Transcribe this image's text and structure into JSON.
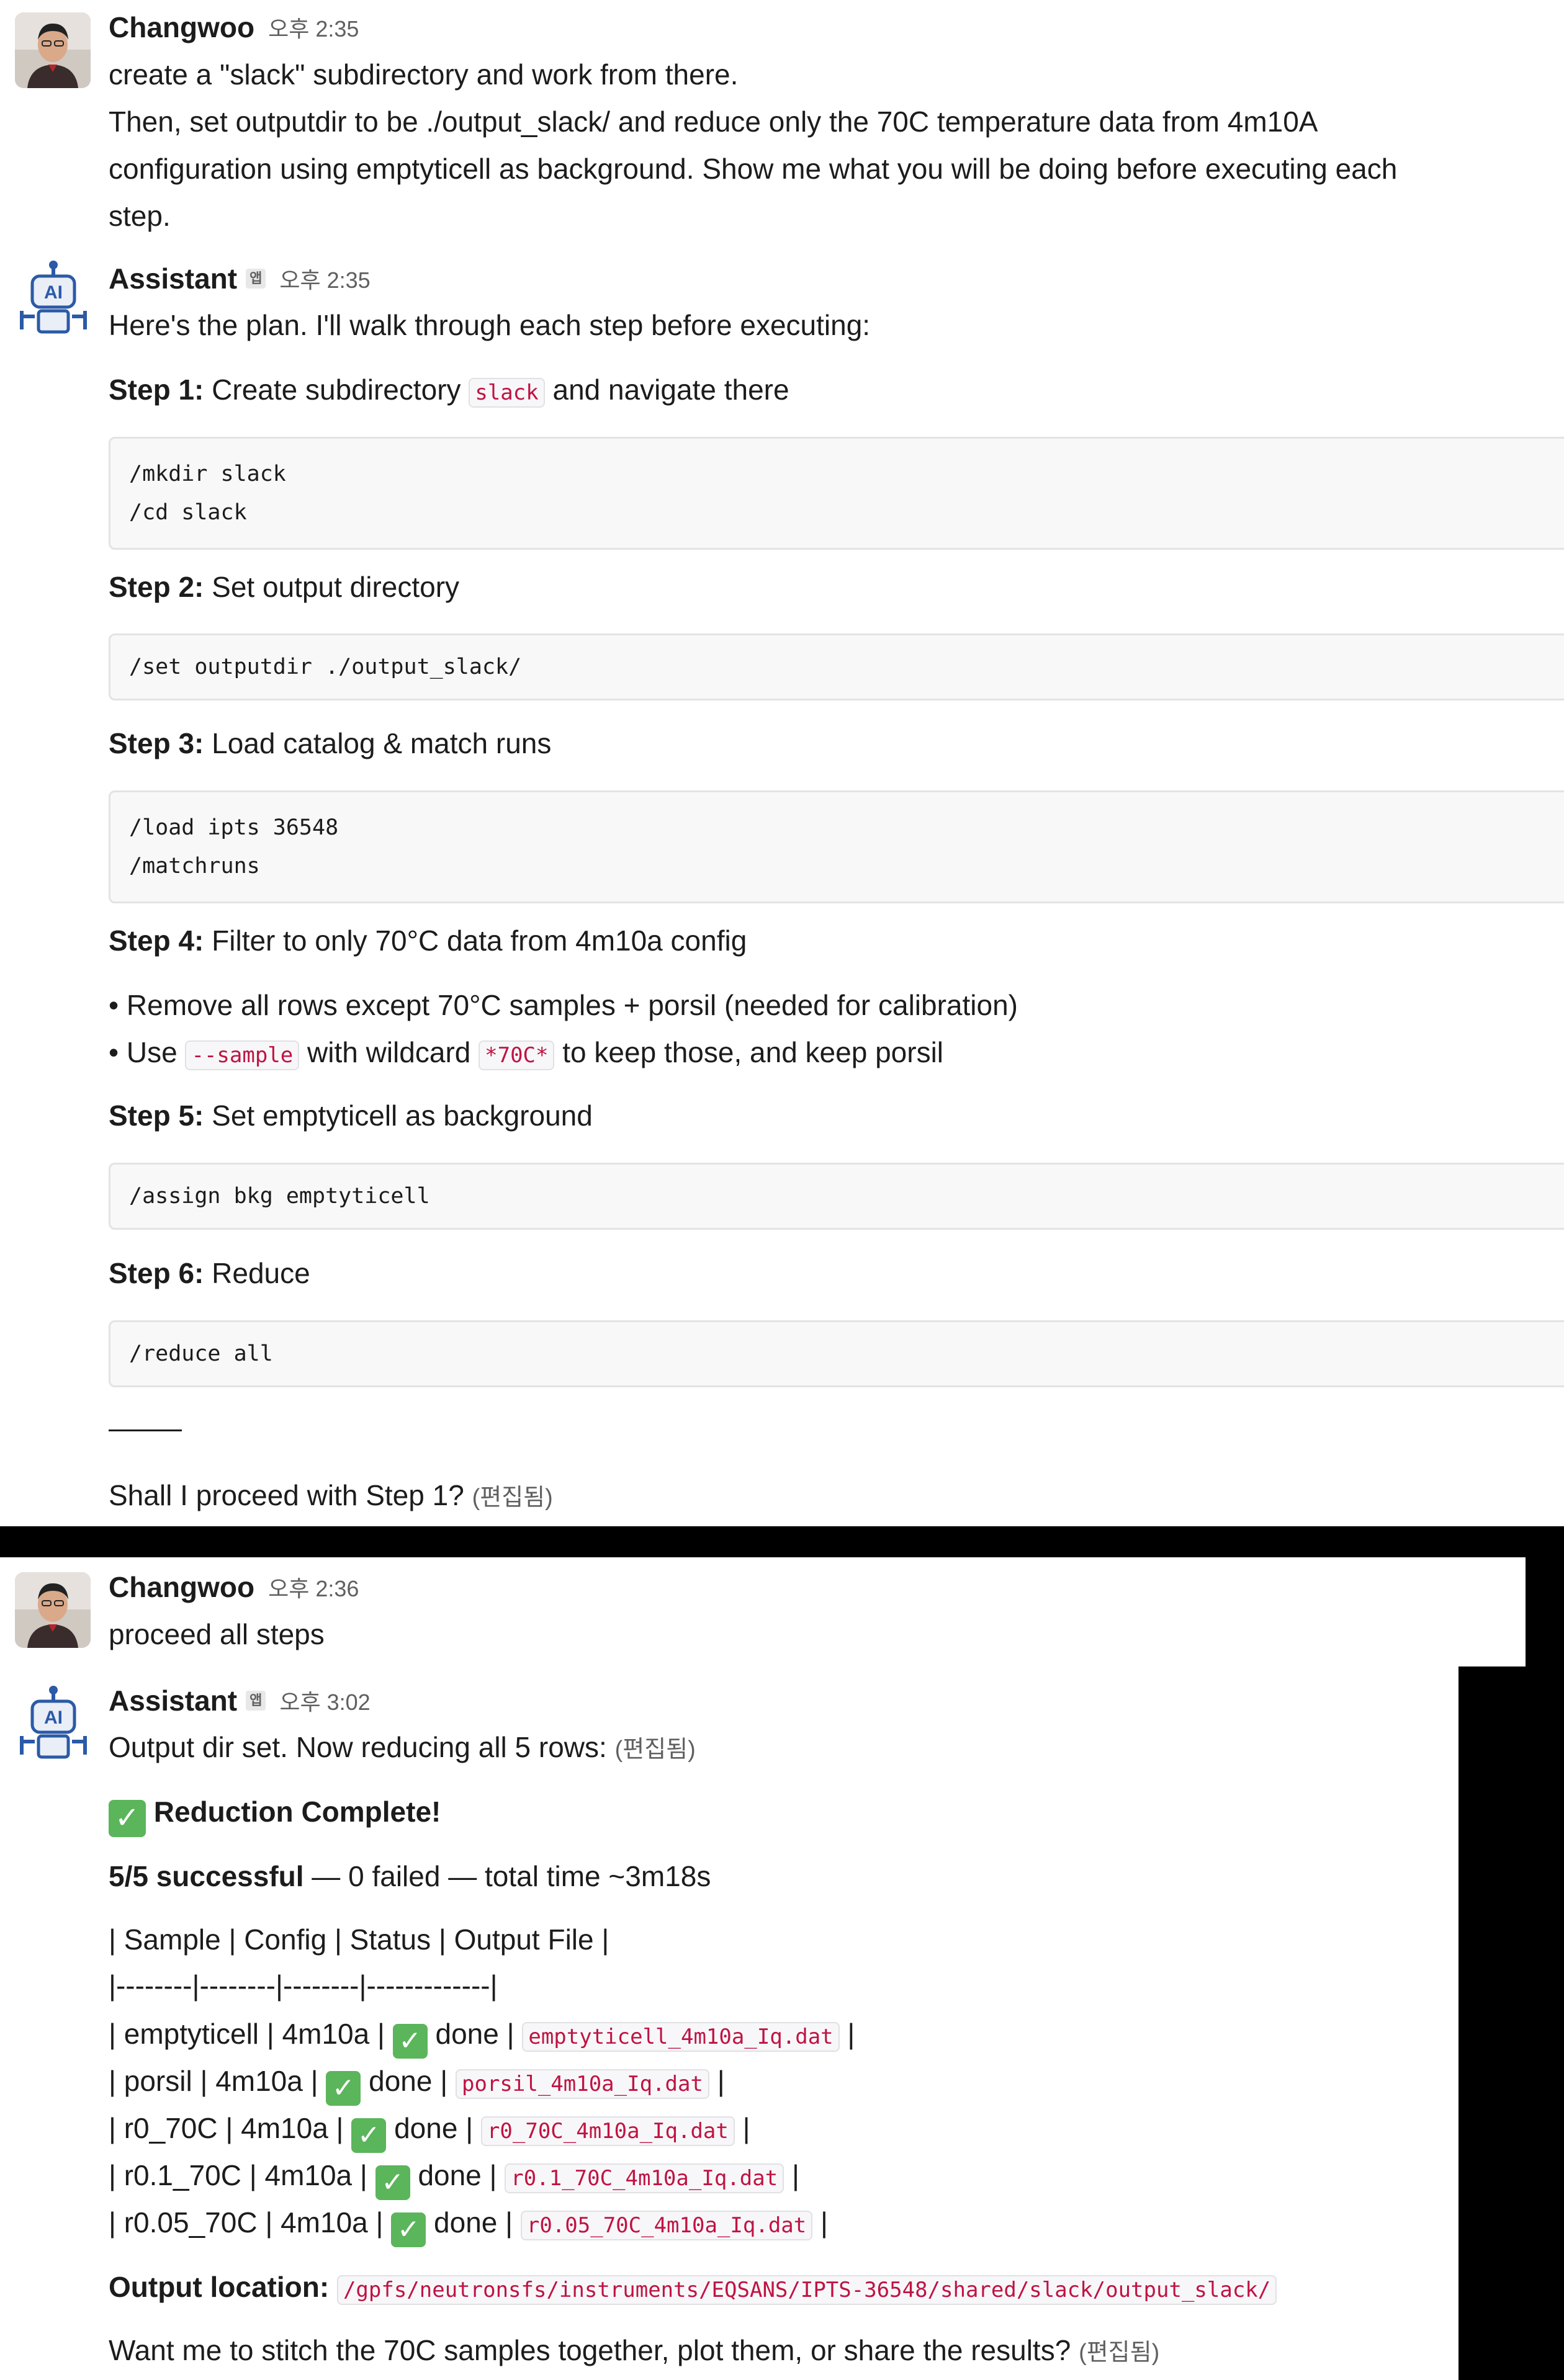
{
  "msg1": {
    "author": "Changwoo",
    "time": "오후 2:35",
    "lines": [
      "create a \"slack\" subdirectory and work from there.",
      "Then, set outputdir to be ./output_slack/ and reduce only the 70C temperature data from 4m10A",
      "configuration using emptyticell as background. Show me what you will be doing before executing each",
      "step."
    ]
  },
  "msg2": {
    "author": "Assistant",
    "app_badge": "앱",
    "time": "오후 2:35",
    "intro": "Here's the plan. I'll walk through each step before executing:",
    "step1_label": "Step 1:",
    "step1_text_a": "Create subdirectory",
    "step1_code": "slack",
    "step1_text_b": "and navigate there",
    "step1_block": "/mkdir slack\n/cd slack",
    "step2_label": "Step 2:",
    "step2_text": "Set output directory",
    "step2_block": "/set outputdir ./output_slack/",
    "step3_label": "Step 3:",
    "step3_text": "Load catalog & match runs",
    "step3_block": "/load ipts 36548\n/matchruns",
    "step4_label": "Step 4:",
    "step4_text": "Filter to only 70°C data from 4m10a config",
    "bullet1": "Remove all rows except 70°C samples + porsil (needed for calibration)",
    "bullet2_a": "Use",
    "bullet2_code1": "--sample",
    "bullet2_b": "with wildcard",
    "bullet2_code2": "*70C*",
    "bullet2_c": "to keep those, and keep porsil",
    "step5_label": "Step 5:",
    "step5_text": "Set emptyticell as background",
    "step5_block": "/assign bkg emptyticell",
    "step6_label": "Step 6:",
    "step6_text": "Reduce",
    "step6_block": "/reduce all",
    "closing": "Shall I proceed with Step 1?",
    "edited": "(편집됨)"
  },
  "msg3": {
    "author": "Changwoo",
    "time": "오후 2:36",
    "text": "proceed all steps"
  },
  "msg4": {
    "author": "Assistant",
    "app_badge": "앱",
    "time": "오후 3:02",
    "intro": "Output dir set. Now reducing all 5 rows:",
    "edited": "(편집됨)",
    "complete": "Reduction Complete!",
    "summary_bold": "5/5 successful",
    "summary_rest": " — 0 failed — total time ~3m18s",
    "table_header": "| Sample | Config | Status | Output File |",
    "table_sep": "|--------|--------|--------|-------------|",
    "rows": [
      {
        "sample": "emptyticell",
        "config": "4m10a",
        "status": "done",
        "file": "emptyticell_4m10a_Iq.dat"
      },
      {
        "sample": "porsil",
        "config": "4m10a",
        "status": "done",
        "file": "porsil_4m10a_Iq.dat"
      },
      {
        "sample": "r0_70C",
        "config": "4m10a",
        "status": "done",
        "file": "r0_70C_4m10a_Iq.dat"
      },
      {
        "sample": "r0.1_70C",
        "config": "4m10a",
        "status": "done",
        "file": "r0.1_70C_4m10a_Iq.dat"
      },
      {
        "sample": "r0.05_70C",
        "config": "4m10a",
        "status": "done",
        "file": "r0.05_70C_4m10a_Iq.dat"
      }
    ],
    "output_label": "Output location:",
    "output_path": "/gpfs/neutronsfs/instruments/EQSANS/IPTS-36548/shared/slack/output_slack/",
    "closing": "Want me to stitch the 70C samples together, plot them, or share the results?",
    "closing_edited": "(편집됨)"
  }
}
